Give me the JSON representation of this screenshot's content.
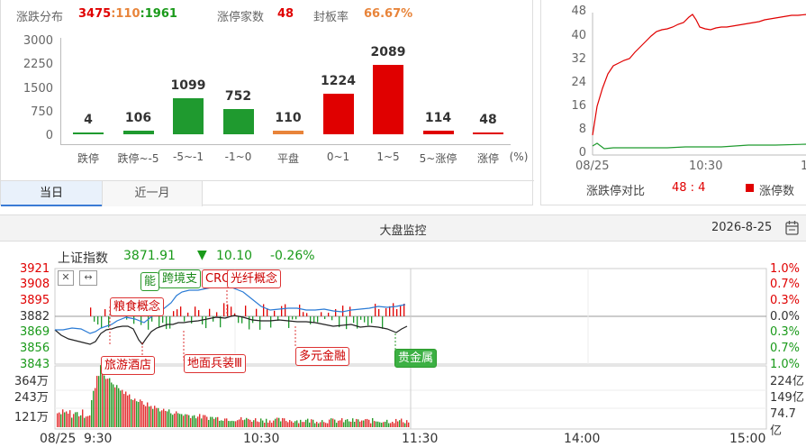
{
  "dist": {
    "header": {
      "dist_label": "涨跌分布",
      "up": "3475",
      "sep1": ":",
      "flat": "110",
      "sep2": ":",
      "down": "1961",
      "limit_label": "涨停家数",
      "limit_value": "48",
      "seal_label": "封板率",
      "seal_value": "66.67%"
    },
    "y_ticks": [
      "3000",
      "2250",
      "1500",
      "750",
      "0"
    ],
    "unit": "(%)",
    "tabs": [
      "当日",
      "近一月"
    ]
  },
  "chart_data": [
    {
      "type": "bar",
      "categories": [
        "跌停",
        "跌停~-5",
        "-5~-1",
        "-1~0",
        "平盘",
        "0~1",
        "1~5",
        "5~涨停",
        "涨停"
      ],
      "values": [
        4,
        106,
        1099,
        752,
        110,
        1224,
        2089,
        114,
        48
      ],
      "value_labels": [
        "4",
        "106",
        "1099",
        "752",
        "110",
        "1224",
        "2089",
        "114",
        "48"
      ],
      "colors": [
        "#1f9a2f",
        "#1f9a2f",
        "#1f9a2f",
        "#1f9a2f",
        "#e8843a",
        "#e00000",
        "#e00000",
        "#e00000",
        "#e00000"
      ],
      "ylim": [
        0,
        3000
      ],
      "grid": false
    },
    {
      "type": "line",
      "y_ticks": [
        "48",
        "40",
        "32",
        "24",
        "16",
        "8",
        "0"
      ],
      "x_ticks": [
        "08/25",
        "10:30"
      ],
      "series": [
        {
          "name": "涨停数",
          "color": "#e00000"
        },
        {
          "color": "#1f9a2f"
        }
      ],
      "ylim": [
        0,
        48
      ]
    }
  ],
  "ratio": {
    "label": "涨跌停对比",
    "value": "48 : 4",
    "legend_label": "涨停数",
    "x_ticks": [
      "08/25",
      "10:30",
      "1"
    ],
    "y_ticks": [
      "48",
      "40",
      "32",
      "24",
      "16",
      "8",
      "0"
    ]
  },
  "section": {
    "title": "大盘监控",
    "date": "2026-8-25"
  },
  "index": {
    "name": "上证指数",
    "price": "3871.91",
    "arrow": "▼",
    "change": "10.10",
    "pct": "-0.26%",
    "left_ticks": [
      "3921",
      "3908",
      "3895",
      "3882",
      "3869",
      "3856",
      "3843"
    ],
    "right_ticks": [
      "1.0%",
      "0.7%",
      "0.3%",
      "0.0%",
      "0.3%",
      "0.7%",
      "1.0%"
    ],
    "vol_left": [
      "364万",
      "243万",
      "121万"
    ],
    "vol_right": [
      "224亿",
      "149亿",
      "74.7亿"
    ],
    "x_ticks": [
      "08/25",
      "9:30",
      "10:30",
      "11:30",
      "14:00",
      "15:00"
    ],
    "events": [
      "粮食概念",
      "旅游酒店",
      "能",
      "跨境支",
      "CRO",
      "光纤概念",
      "地面兵装Ⅲ",
      "多元金融",
      "贵金属"
    ]
  }
}
